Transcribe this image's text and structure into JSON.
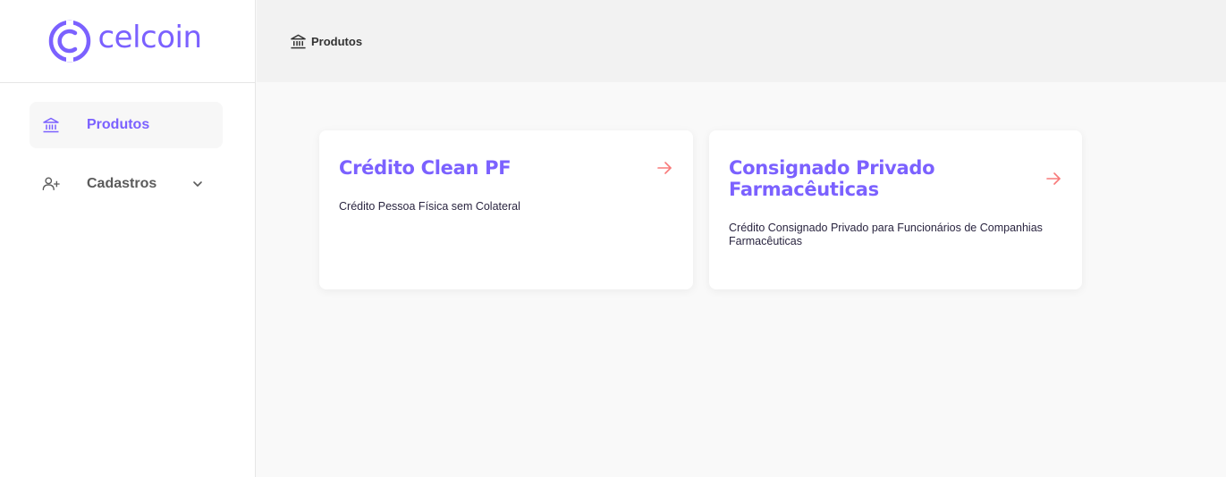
{
  "brand": {
    "name": "celcoin",
    "color": "#7b61ff"
  },
  "sidebar": {
    "items": [
      {
        "label": "Produtos",
        "icon": "bank-icon",
        "active": true
      },
      {
        "label": "Cadastros",
        "icon": "user-add-icon",
        "active": false,
        "expandable": true
      }
    ]
  },
  "header": {
    "breadcrumb": {
      "icon": "bank-icon",
      "label": "Produtos"
    }
  },
  "products": [
    {
      "title": "Crédito Clean PF",
      "description": "Crédito Pessoa Física sem Colateral",
      "icon": "arrow-right-icon"
    },
    {
      "title": "Consignado Privado Farmacêuticas",
      "description": "Crédito Consignado Privado para Funcionários de Companhias Farmacêuticas",
      "icon": "arrow-right-icon"
    }
  ],
  "colors": {
    "accent": "#7b61ff",
    "arrow": "#f87a7a",
    "text": "#2a2540"
  }
}
